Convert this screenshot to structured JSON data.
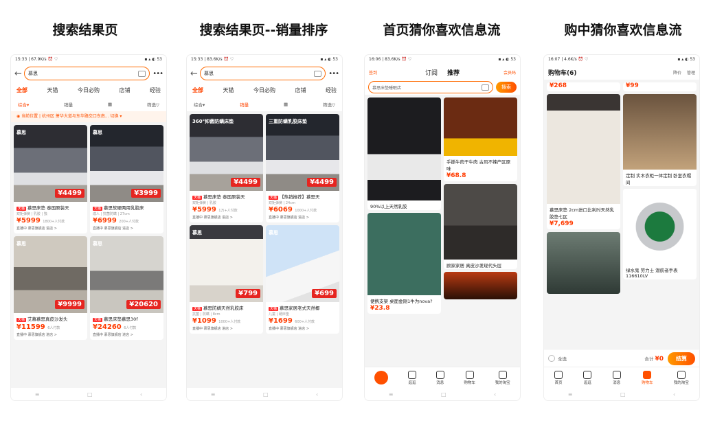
{
  "headings": [
    "搜索结果页",
    "搜索结果页--销量排序",
    "首页猜你喜欢信息流",
    "购中猜你喜欢信息流"
  ],
  "search": {
    "status_left": "15:33 | 67.9K/s ⏰ ♡",
    "status_right": "▪ ▴ ◐ 53",
    "status_left_2": "15:33 | 83.6K/s ⏰ ♡",
    "query": "慕思",
    "tabs": [
      "全部",
      "天猫",
      "今日必购",
      "店铺",
      "经验"
    ],
    "filters": [
      "综合▾",
      "销量",
      "▦",
      "筛选▽"
    ],
    "location": "◉ 当前位置 | 杭州区 萧华大道与东华路交口东南... 切换 ▾",
    "products": [
      {
        "tag": "慕思",
        "badge": "¥4499",
        "brand": "天猫",
        "title": "慕思床垫 泰国原装天",
        "sub": "双矩弹簧 | 乳胶 | 独",
        "price": "¥5999",
        "sales": "1800+人付款",
        "shop": "直播中 慕思旗舰店 进店 >"
      },
      {
        "tag": "慕思",
        "badge": "¥3999",
        "brand": "天猫",
        "title": "慕思软硬两用乳胶床",
        "sub": "成人 | 抗菌防螨 | 27cm",
        "price": "¥6999",
        "sales": "200+人付款",
        "shop": "直播中 慕思旗舰店 进店 >"
      },
      {
        "tag": "慕思",
        "badge": "¥9999",
        "brand": "天猫",
        "title": "艾慕慕思真皮沙发头",
        "sub": "",
        "price": "¥11599",
        "sales": "6人付款",
        "shop": "直播中 慕思旗舰店 进店 >"
      },
      {
        "tag": "慕思",
        "badge": "¥20620",
        "brand": "天猫",
        "title": "慕思床垫慕思30f",
        "sub": "",
        "price": "¥24260",
        "sales": "6人付款",
        "shop": "直播中 慕思旗舰店 进店 >"
      }
    ],
    "products_sales": [
      {
        "tag": "360°抑菌防螨床垫",
        "badge": "¥4499",
        "brand": "天猫",
        "title": "慕思床垫 泰国原装天",
        "sub": "双矩弹簧 | 乳胶",
        "price": "¥5999",
        "sales": "1万+人付款",
        "shop": "直播中 慕思旗舰店 进店 >"
      },
      {
        "tag": "三重防螨乳胶床垫",
        "badge": "¥4499",
        "brand": "天猫",
        "title": "【热销推荐】慕思天",
        "sub": "双矩弹簧 | 24cm",
        "price": "¥6069",
        "sales": "1000+人付款",
        "shop": "直播中 慕思旗舰店 进店 >"
      },
      {
        "tag": "慕思",
        "badge": "¥799",
        "brand": "天猫",
        "title": "慕思防螨天然乳胶床",
        "sub": "抗菌 | 防螨 | 8cm",
        "price": "¥1099",
        "sales": "1000+人付款",
        "shop": "直播中 慕思旗舰店 进店 >"
      },
      {
        "tag": "慕思",
        "badge": "¥699",
        "brand": "天猫",
        "title": "慕思家居老式天然椰",
        "sub": "儿童 | 硬床垫",
        "price": "¥1699",
        "sales": "600+人付款",
        "shop": "直播中 慕思旗舰店 进店 >"
      }
    ]
  },
  "home": {
    "status_left": "16:06 | 83.6K/s ⏰ ♡",
    "header_left": "签到",
    "header_tabs": [
      "订阅",
      "推荐"
    ],
    "header_right": "会员码",
    "search_placeholder": "慕思床垫睡眠店",
    "search_btn": "搜索",
    "feed_left": [
      {
        "text": "90%以上天然乳胶",
        "price": ""
      },
      {
        "text": "便携支架 桌面金刚1牛为nova?",
        "price": "¥23.8"
      }
    ],
    "feed_right": [
      {
        "text": "手撕牛肉干牛肉 古风不辣产区原味",
        "price": "¥68.8"
      },
      {
        "text": "顾家家居 真皮沙发现代头层",
        "price": ""
      }
    ],
    "tabs": [
      "首页",
      "逛逛",
      "消息",
      "购物车",
      "我的淘宝"
    ]
  },
  "cart": {
    "status_left": "16:07 | 4.6K/s ⏰ ♡",
    "title": "购物车(6)",
    "ops": [
      "降价",
      "管理"
    ],
    "feed_left": [
      {
        "text": "慕思床垫 2cm进口比利时天然乳胶垫七区",
        "price": "¥7,699"
      },
      {
        "text": "",
        "price": "¥268"
      }
    ],
    "feed_right": [
      {
        "text": "定制 实木衣柜一体定制 卧室衣帽间",
        "price": "¥99"
      },
      {
        "text": "绿水鬼 劳力士 潜航者手表 116610LV",
        "price": ""
      }
    ],
    "select_all": "全选",
    "total_label": "合计",
    "total_value": "¥0",
    "settle": "结算",
    "tabs": [
      "首页",
      "逛逛",
      "消息",
      "购物车",
      "我的淘宝"
    ]
  }
}
